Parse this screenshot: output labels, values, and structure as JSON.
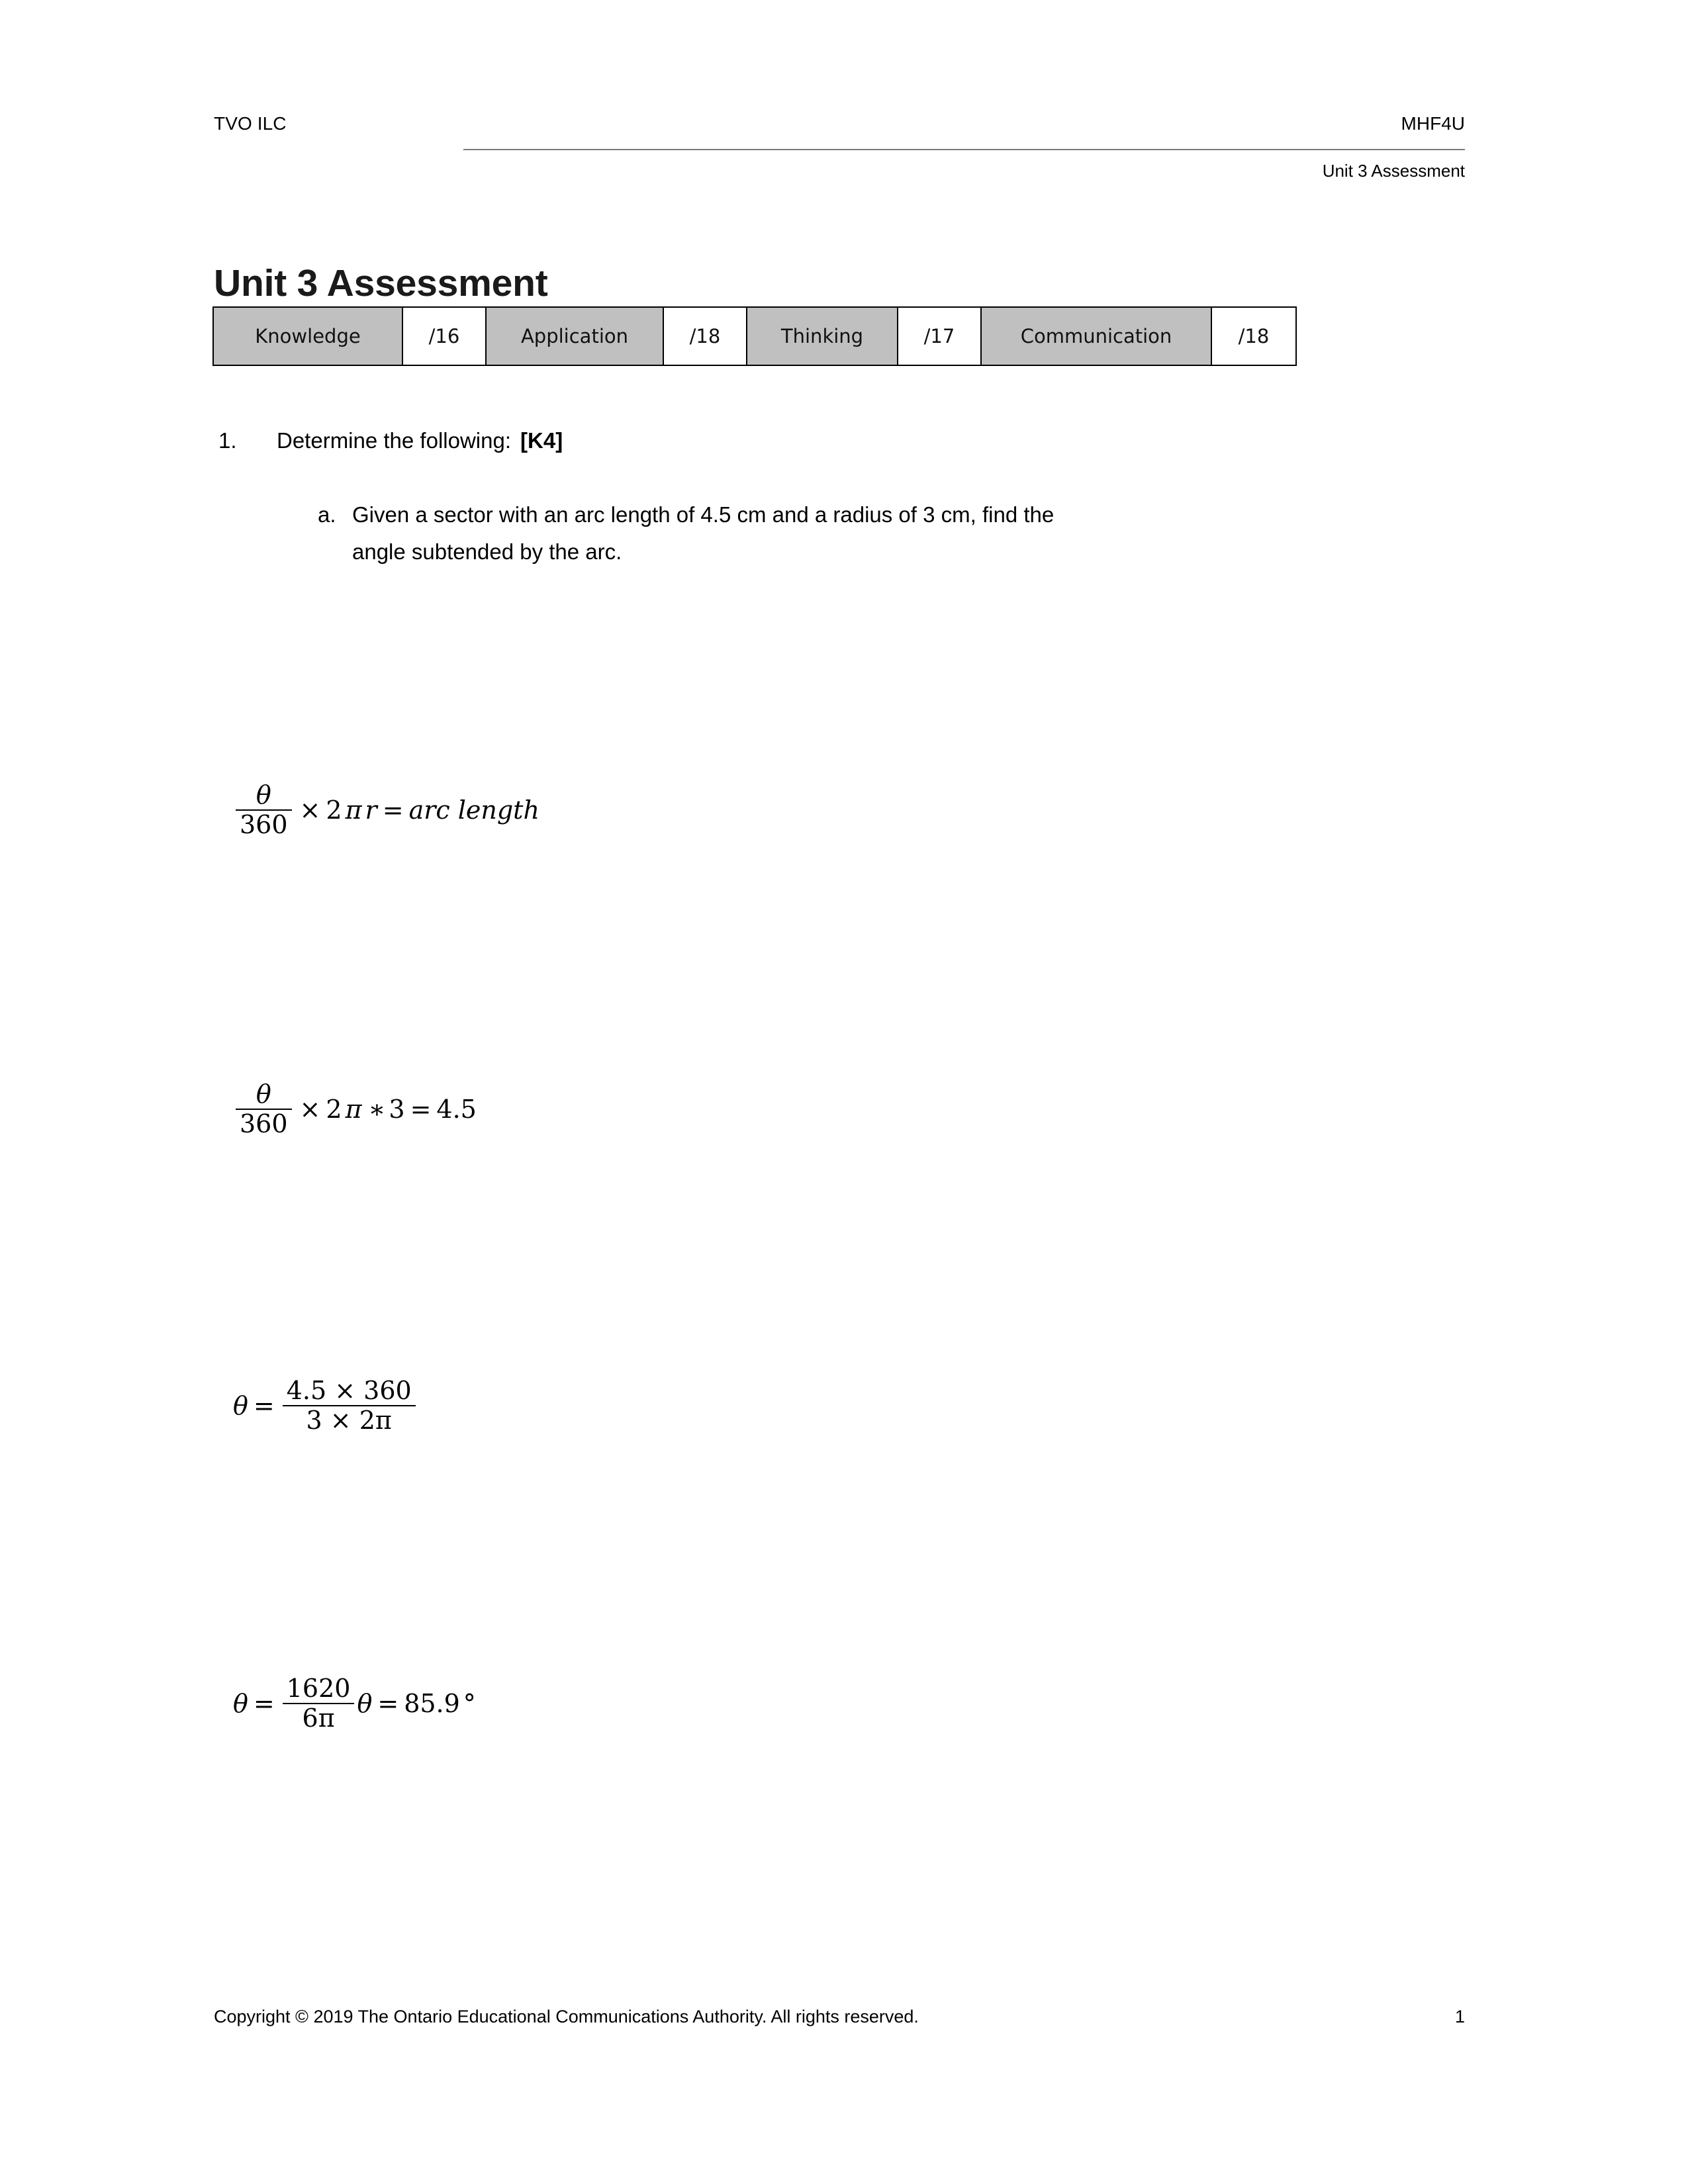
{
  "header": {
    "left": "TVO ILC",
    "right": "MHF4U",
    "subtitle": "Unit 3 Assessment"
  },
  "title": "Unit 3 Assessment",
  "marks_table": {
    "cells": [
      {
        "label": "Knowledge",
        "score": "/16"
      },
      {
        "label": "Application",
        "score": "/18"
      },
      {
        "label": "Thinking",
        "score": "/17"
      },
      {
        "label": "Communication",
        "score": "/18"
      }
    ]
  },
  "question": {
    "number": "1.",
    "prompt": "Determine the following:",
    "mark_tag": "[K4]",
    "parts": [
      {
        "letter": "a.",
        "line1": "Given a sector with an arc length of 4.5 cm and a  radius of 3 cm, find the",
        "line2": "angle subtended by the arc."
      }
    ]
  },
  "equations": [
    {
      "id": "eq1",
      "plain": "θ/360 × 2πr = arc length",
      "numerator": "θ",
      "denominator": "360",
      "op1": "×",
      "factor": "2",
      "symbol": "π",
      "variable": "r",
      "equals": "=",
      "result": "arc length"
    },
    {
      "id": "eq2",
      "plain": "θ/360 × 2π∗3 = 4.5",
      "numerator": "θ",
      "denominator": "360",
      "op1": "×",
      "factor": "2",
      "symbol": "π",
      "op2": "∗",
      "factor2": "3",
      "equals": "=",
      "result": "4.5"
    },
    {
      "id": "eq3",
      "plain": "θ = (4.5 × 360) / (3 × 2π)",
      "lhs": "θ",
      "equals": "=",
      "numerator": "4.5 × 360",
      "denominator": "3 × 2π"
    },
    {
      "id": "eq4",
      "plain": "θ = 1620/(6π)  θ = 85.9 °",
      "lhs": "θ",
      "equals": "=",
      "numerator": "1620",
      "denominator": "6π",
      "lhs2": "θ",
      "equals2": "=",
      "result": "85.9",
      "degree": "°"
    }
  ],
  "footer": {
    "copyright": "Copyright © 2019 The Ontario Educational Communications Authority. All rights reserved.",
    "page_number": "1"
  },
  "colors": {
    "category_cell": "#c0c0c0",
    "rule": "#7b7b7b",
    "text": "#000000"
  }
}
